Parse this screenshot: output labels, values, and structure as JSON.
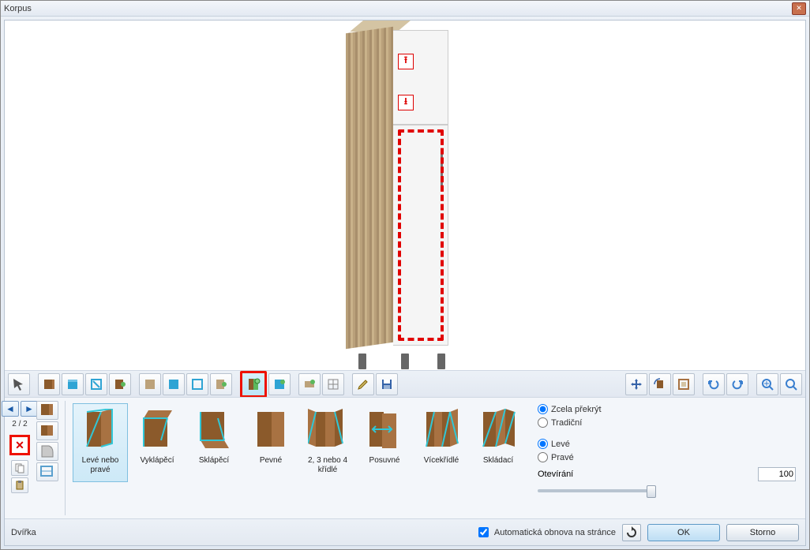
{
  "window": {
    "title": "Korpus"
  },
  "footer": {
    "status": "Dvířka",
    "autoRefresh": "Automatická obnova na stránce",
    "ok": "OK",
    "cancel": "Storno"
  },
  "nav": {
    "page": "2 / 2"
  },
  "options": {
    "overlay_full": "Zcela překrýt",
    "overlay_trad": "Tradiční",
    "side_left": "Levé",
    "side_right": "Pravé",
    "opening_label": "Otevírání",
    "opening_value": "100"
  },
  "gallery": [
    {
      "label": "Levé nebo pravé"
    },
    {
      "label": "Vyklápěcí"
    },
    {
      "label": "Sklápěcí"
    },
    {
      "label": "Pevné"
    },
    {
      "label": "2, 3 nebo 4 křídlé"
    },
    {
      "label": "Posuvné"
    },
    {
      "label": "Vícekřídlé"
    },
    {
      "label": "Skládací"
    }
  ]
}
